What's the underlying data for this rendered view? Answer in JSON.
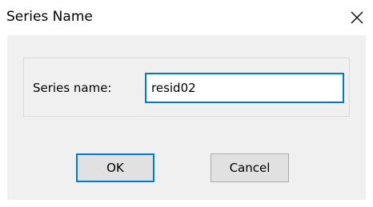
{
  "window": {
    "title": "Series Name",
    "close_icon": "close-icon"
  },
  "form": {
    "series_name_label": "Series name:",
    "series_name_value": "resid02"
  },
  "buttons": {
    "ok_label": "OK",
    "cancel_label": "Cancel"
  },
  "colors": {
    "accent": "#0078d7",
    "client_background": "#f0f0f0",
    "button_face": "#e1e1e1"
  }
}
